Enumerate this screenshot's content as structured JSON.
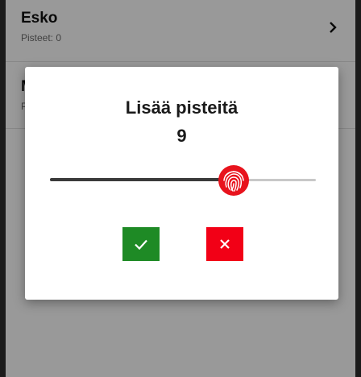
{
  "players": [
    {
      "name": "Esko",
      "points_label": "Pisteet: 0"
    },
    {
      "name": "M",
      "points_label": "P"
    }
  ],
  "dialog": {
    "title": "Lisää pisteitä",
    "value": "9",
    "slider": {
      "value": 9,
      "min": 0,
      "max": 13
    },
    "confirm_icon": "check-icon",
    "cancel_icon": "close-icon"
  },
  "colors": {
    "confirm": "#1e8a25",
    "cancel": "#f20016",
    "thumb": "#e8131d"
  }
}
